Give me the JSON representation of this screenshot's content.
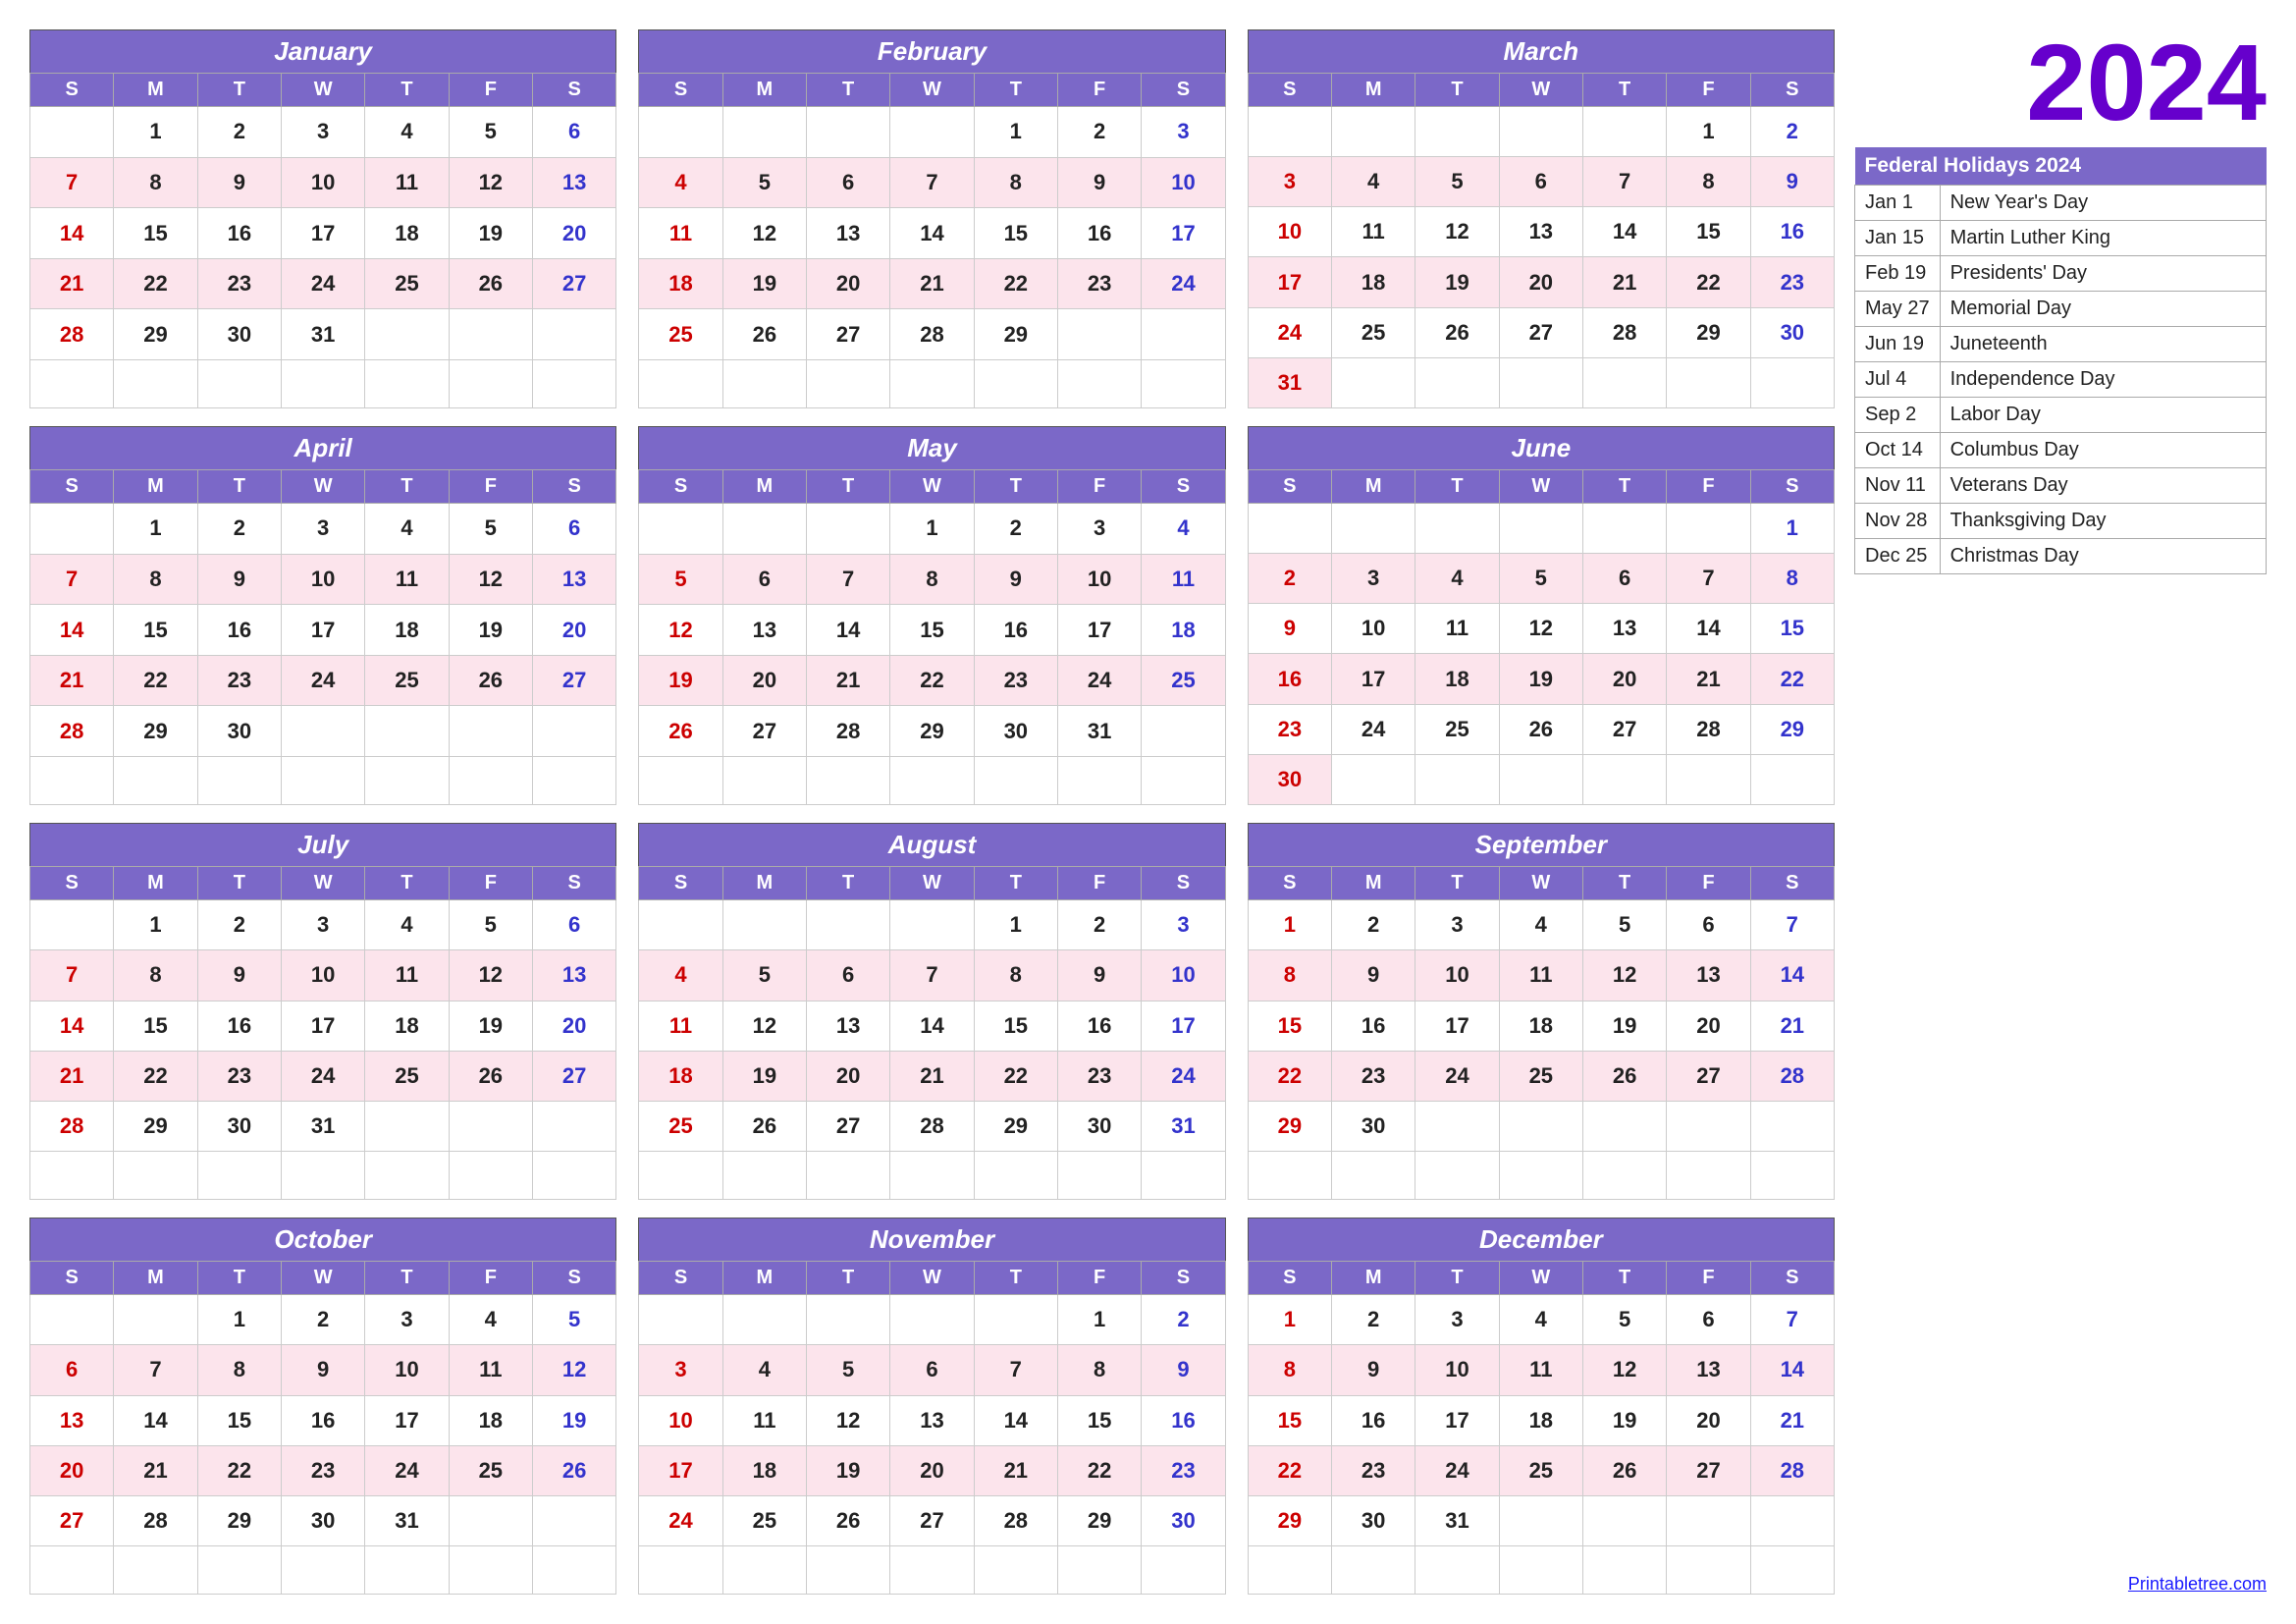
{
  "year": "2024",
  "holidays_header": "Federal Holidays 2024",
  "holidays": [
    {
      "date": "Jan 1",
      "name": "New Year's Day"
    },
    {
      "date": "Jan 15",
      "name": "Martin Luther King"
    },
    {
      "date": "Feb 19",
      "name": "Presidents' Day"
    },
    {
      "date": "May 27",
      "name": "Memorial Day"
    },
    {
      "date": "Jun 19",
      "name": "Juneteenth"
    },
    {
      "date": "Jul 4",
      "name": "Independence Day"
    },
    {
      "date": "Sep 2",
      "name": "Labor Day"
    },
    {
      "date": "Oct 14",
      "name": "Columbus Day"
    },
    {
      "date": "Nov 11",
      "name": "Veterans Day"
    },
    {
      "date": "Nov 28",
      "name": "Thanksgiving Day"
    },
    {
      "date": "Dec 25",
      "name": "Christmas Day"
    }
  ],
  "months": [
    {
      "name": "January",
      "days": [
        [
          "",
          "1",
          "2",
          "3",
          "4",
          "5",
          "6"
        ],
        [
          "7",
          "8",
          "9",
          "10",
          "11",
          "12",
          "13"
        ],
        [
          "14",
          "15",
          "16",
          "17",
          "18",
          "19",
          "20"
        ],
        [
          "21",
          "22",
          "23",
          "24",
          "25",
          "26",
          "27"
        ],
        [
          "28",
          "29",
          "30",
          "31",
          "",
          "",
          ""
        ],
        [
          "",
          "",
          "",
          "",
          "",
          "",
          ""
        ]
      ]
    },
    {
      "name": "February",
      "days": [
        [
          "",
          "",
          "",
          "",
          "1",
          "2",
          "3"
        ],
        [
          "4",
          "5",
          "6",
          "7",
          "8",
          "9",
          "10"
        ],
        [
          "11",
          "12",
          "13",
          "14",
          "15",
          "16",
          "17"
        ],
        [
          "18",
          "19",
          "20",
          "21",
          "22",
          "23",
          "24"
        ],
        [
          "25",
          "26",
          "27",
          "28",
          "29",
          "",
          ""
        ],
        [
          "",
          "",
          "",
          "",
          "",
          "",
          ""
        ]
      ]
    },
    {
      "name": "March",
      "days": [
        [
          "",
          "",
          "",
          "",
          "",
          "1",
          "2"
        ],
        [
          "3",
          "4",
          "5",
          "6",
          "7",
          "8",
          "9"
        ],
        [
          "10",
          "11",
          "12",
          "13",
          "14",
          "15",
          "16"
        ],
        [
          "17",
          "18",
          "19",
          "20",
          "21",
          "22",
          "23"
        ],
        [
          "24",
          "25",
          "26",
          "27",
          "28",
          "29",
          "30"
        ],
        [
          "31",
          "",
          "",
          "",
          "",
          "",
          ""
        ]
      ]
    },
    {
      "name": "April",
      "days": [
        [
          "",
          "1",
          "2",
          "3",
          "4",
          "5",
          "6"
        ],
        [
          "7",
          "8",
          "9",
          "10",
          "11",
          "12",
          "13"
        ],
        [
          "14",
          "15",
          "16",
          "17",
          "18",
          "19",
          "20"
        ],
        [
          "21",
          "22",
          "23",
          "24",
          "25",
          "26",
          "27"
        ],
        [
          "28",
          "29",
          "30",
          "",
          "",
          "",
          ""
        ],
        [
          "",
          "",
          "",
          "",
          "",
          "",
          ""
        ]
      ]
    },
    {
      "name": "May",
      "days": [
        [
          "",
          "",
          "",
          "1",
          "2",
          "3",
          "4"
        ],
        [
          "5",
          "6",
          "7",
          "8",
          "9",
          "10",
          "11"
        ],
        [
          "12",
          "13",
          "14",
          "15",
          "16",
          "17",
          "18"
        ],
        [
          "19",
          "20",
          "21",
          "22",
          "23",
          "24",
          "25"
        ],
        [
          "26",
          "27",
          "28",
          "29",
          "30",
          "31",
          ""
        ],
        [
          "",
          "",
          "",
          "",
          "",
          "",
          ""
        ]
      ]
    },
    {
      "name": "June",
      "days": [
        [
          "",
          "",
          "",
          "",
          "",
          "",
          "1"
        ],
        [
          "2",
          "3",
          "4",
          "5",
          "6",
          "7",
          "8"
        ],
        [
          "9",
          "10",
          "11",
          "12",
          "13",
          "14",
          "15"
        ],
        [
          "16",
          "17",
          "18",
          "19",
          "20",
          "21",
          "22"
        ],
        [
          "23",
          "24",
          "25",
          "26",
          "27",
          "28",
          "29"
        ],
        [
          "30",
          "",
          "",
          "",
          "",
          "",
          ""
        ]
      ]
    },
    {
      "name": "July",
      "days": [
        [
          "",
          "1",
          "2",
          "3",
          "4",
          "5",
          "6"
        ],
        [
          "7",
          "8",
          "9",
          "10",
          "11",
          "12",
          "13"
        ],
        [
          "14",
          "15",
          "16",
          "17",
          "18",
          "19",
          "20"
        ],
        [
          "21",
          "22",
          "23",
          "24",
          "25",
          "26",
          "27"
        ],
        [
          "28",
          "29",
          "30",
          "31",
          "",
          "",
          ""
        ],
        [
          "",
          "",
          "",
          "",
          "",
          "",
          ""
        ]
      ]
    },
    {
      "name": "August",
      "days": [
        [
          "",
          "",
          "",
          "",
          "1",
          "2",
          "3"
        ],
        [
          "4",
          "5",
          "6",
          "7",
          "8",
          "9",
          "10"
        ],
        [
          "11",
          "12",
          "13",
          "14",
          "15",
          "16",
          "17"
        ],
        [
          "18",
          "19",
          "20",
          "21",
          "22",
          "23",
          "24"
        ],
        [
          "25",
          "26",
          "27",
          "28",
          "29",
          "30",
          "31"
        ],
        [
          "",
          "",
          "",
          "",
          "",
          "",
          ""
        ]
      ]
    },
    {
      "name": "September",
      "days": [
        [
          "1",
          "2",
          "3",
          "4",
          "5",
          "6",
          "7"
        ],
        [
          "8",
          "9",
          "10",
          "11",
          "12",
          "13",
          "14"
        ],
        [
          "15",
          "16",
          "17",
          "18",
          "19",
          "20",
          "21"
        ],
        [
          "22",
          "23",
          "24",
          "25",
          "26",
          "27",
          "28"
        ],
        [
          "29",
          "30",
          "",
          "",
          "",
          "",
          ""
        ],
        [
          "",
          "",
          "",
          "",
          "",
          "",
          ""
        ]
      ]
    },
    {
      "name": "October",
      "days": [
        [
          "",
          "",
          "1",
          "2",
          "3",
          "4",
          "5"
        ],
        [
          "6",
          "7",
          "8",
          "9",
          "10",
          "11",
          "12"
        ],
        [
          "13",
          "14",
          "15",
          "16",
          "17",
          "18",
          "19"
        ],
        [
          "20",
          "21",
          "22",
          "23",
          "24",
          "25",
          "26"
        ],
        [
          "27",
          "28",
          "29",
          "30",
          "31",
          "",
          ""
        ],
        [
          "",
          "",
          "",
          "",
          "",
          "",
          ""
        ]
      ]
    },
    {
      "name": "November",
      "days": [
        [
          "",
          "",
          "",
          "",
          "",
          "1",
          "2"
        ],
        [
          "3",
          "4",
          "5",
          "6",
          "7",
          "8",
          "9"
        ],
        [
          "10",
          "11",
          "12",
          "13",
          "14",
          "15",
          "16"
        ],
        [
          "17",
          "18",
          "19",
          "20",
          "21",
          "22",
          "23"
        ],
        [
          "24",
          "25",
          "26",
          "27",
          "28",
          "29",
          "30"
        ],
        [
          "",
          "",
          "",
          "",
          "",
          "",
          ""
        ]
      ]
    },
    {
      "name": "December",
      "days": [
        [
          "1",
          "2",
          "3",
          "4",
          "5",
          "6",
          "7"
        ],
        [
          "8",
          "9",
          "10",
          "11",
          "12",
          "13",
          "14"
        ],
        [
          "15",
          "16",
          "17",
          "18",
          "19",
          "20",
          "21"
        ],
        [
          "22",
          "23",
          "24",
          "25",
          "26",
          "27",
          "28"
        ],
        [
          "29",
          "30",
          "31",
          "",
          "",
          "",
          ""
        ],
        [
          "",
          "",
          "",
          "",
          "",
          "",
          ""
        ]
      ]
    }
  ],
  "day_headers": [
    "S",
    "M",
    "T",
    "W",
    "T",
    "F",
    "S"
  ],
  "printabletree": "Printabletree.com"
}
